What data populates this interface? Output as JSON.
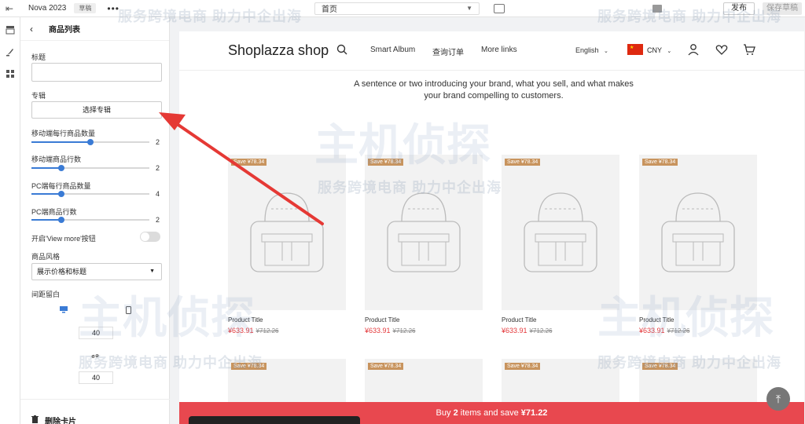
{
  "topbar": {
    "theme": "Nova 2023",
    "badge": "草稿",
    "page": "首页",
    "publish": "发布",
    "save": "保存草稿"
  },
  "panel": {
    "title": "商品列表",
    "title_label": "标题",
    "album_label": "专辑",
    "album_button": "选择专辑",
    "mobile_per_row": {
      "label": "移动端每行商品数量",
      "value": "2",
      "fraction": 0.5
    },
    "mobile_rows": {
      "label": "移动端商品行数",
      "value": "2",
      "fraction": 0.25
    },
    "pc_per_row": {
      "label": "PC端每行商品数量",
      "value": "4",
      "fraction": 0.25
    },
    "pc_rows": {
      "label": "PC端商品行数",
      "value": "2",
      "fraction": 0.25
    },
    "view_more": "开启'View more'按钮",
    "style_label": "商品风格",
    "style_value": "展示价格和标题",
    "spacing_label": "间距留白",
    "spacing_top": "40",
    "spacing_bottom": "40",
    "delete": "删除卡片"
  },
  "preview": {
    "logo": "Shoplazza shop",
    "nav_links": [
      "Smart Album",
      "查询订单",
      "More links"
    ],
    "language": "English",
    "currency": "CNY",
    "intro": "A sentence or two introducing your brand, what you sell, and what makes your brand compelling to customers.",
    "products": [
      {
        "badge": "Save ¥78.34",
        "title": "Product Title",
        "price": "¥633.91",
        "old_price": "¥712.26"
      },
      {
        "badge": "Save ¥78.34",
        "title": "Product Title",
        "price": "¥633.91",
        "old_price": "¥712.26"
      },
      {
        "badge": "Save ¥78.34",
        "title": "Product Title",
        "price": "¥633.91",
        "old_price": "¥712.26"
      },
      {
        "badge": "Save ¥78.34",
        "title": "Product Title",
        "price": "¥633.91",
        "old_price": "¥712.26"
      }
    ],
    "products_row2": [
      {
        "badge": "Save ¥78.34"
      },
      {
        "badge": "Save ¥78.34"
      },
      {
        "badge": "Save ¥78.34"
      },
      {
        "badge": "Save ¥78.34"
      }
    ],
    "bottom_bar": {
      "pre": "Buy ",
      "count": "2",
      "mid": " items and save ",
      "amount": "¥71.22"
    }
  },
  "watermark": {
    "text": "服务跨境电商 助力中企出海",
    "brand": "主机侦探"
  },
  "colors": {
    "accent": "#3a7bd5",
    "sale": "#e4393c",
    "bar": "#e8484f",
    "badge": "#c8945e",
    "arrow": "#e53935"
  }
}
